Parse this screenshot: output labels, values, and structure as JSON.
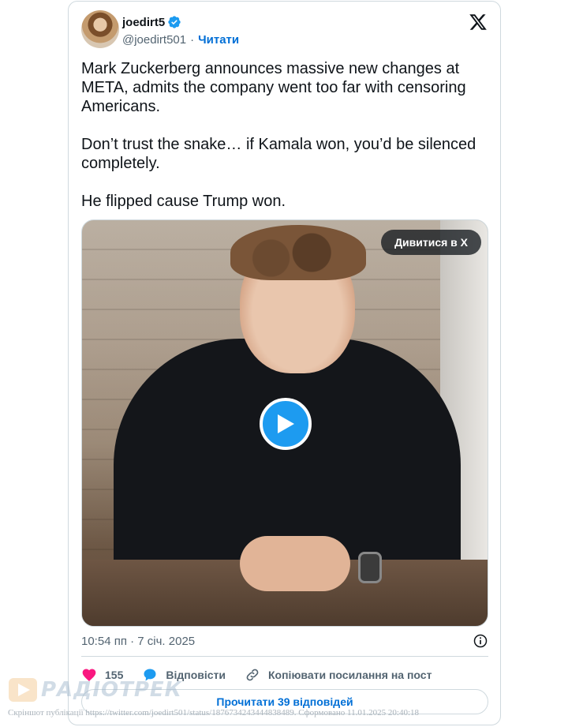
{
  "tweet": {
    "display_name": "joedirt5",
    "handle": "@joedirt501",
    "follow_label": "Читати",
    "paragraphs": [
      "Mark Zuckerberg announces massive new changes at META, admits the company went too far with censoring Americans.",
      "Don’t trust the snake… if Kamala won, you’d be silenced completely.",
      "He flipped cause Trump won."
    ],
    "timestamp": "10:54 пп · 7 січ. 2025"
  },
  "media": {
    "watch_label": "Дивитися в X"
  },
  "actions": {
    "likes": "155",
    "reply_label": "Відповісти",
    "copy_label": "Копіювати посилання на пост",
    "read_replies_label": "Прочитати 39 відповідей"
  },
  "watermark": {
    "logo_text": "РАДІОТРЕК",
    "caption": "Скріншот публікації https://twitter.com/joedirt501/status/1876734243444838489. Сформовано 11.01.2025 20:40:18"
  },
  "colors": {
    "accent": "#1d9bf0",
    "link": "#006fd6",
    "like": "#f91880",
    "muted": "#536471"
  },
  "icons": [
    "verified-badge-icon",
    "x-logo-icon",
    "play-icon",
    "info-icon",
    "heart-icon",
    "reply-bubble-icon",
    "link-icon"
  ]
}
